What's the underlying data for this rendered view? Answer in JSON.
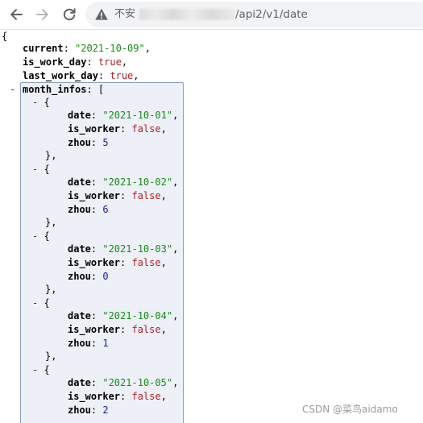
{
  "browser": {
    "security_label": "不安",
    "url_path": "/api2/v1/date",
    "icons": {
      "back": "arrow-left-icon",
      "forward": "arrow-right-icon",
      "reload": "reload-icon",
      "security": "warning-triangle-icon"
    }
  },
  "json": {
    "open_brace": "{",
    "current": {
      "key": "current",
      "value": "\"2021-10-09\""
    },
    "is_work_day": {
      "key": "is_work_day",
      "value": "true"
    },
    "last_work_day": {
      "key": "last_work_day",
      "value": "true"
    },
    "month_infos_key": "month_infos",
    "collapse_toggle": "-",
    "entries": [
      {
        "date": "\"2021-10-01\"",
        "is_worker": "false",
        "zhou": "5"
      },
      {
        "date": "\"2021-10-02\"",
        "is_worker": "false",
        "zhou": "6"
      },
      {
        "date": "\"2021-10-03\"",
        "is_worker": "false",
        "zhou": "0"
      },
      {
        "date": "\"2021-10-04\"",
        "is_worker": "false",
        "zhou": "1"
      },
      {
        "date": "\"2021-10-05\"",
        "is_worker": "false",
        "zhou": "2"
      }
    ],
    "entry_keys": {
      "date": "date",
      "is_worker": "is_worker",
      "zhou": "zhou"
    }
  },
  "colors": {
    "string": "#1a8a1a",
    "number": "#1a1aa6",
    "boolean": "#b02020",
    "highlight_bg": "#eef0f8",
    "highlight_border": "#8c9bc0"
  },
  "watermark": "CSDN @菜鸟aidamo"
}
